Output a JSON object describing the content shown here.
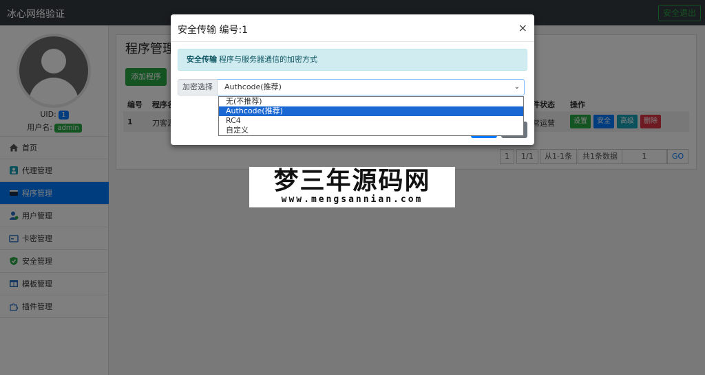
{
  "app": {
    "title": "冰心网络验证",
    "logout_label": "安全退出"
  },
  "user": {
    "uid_label": "UID:",
    "uid": "1",
    "name_label": "用户名:",
    "name": "admin"
  },
  "sidebar": {
    "items": [
      {
        "label": "首页",
        "icon": "home-icon"
      },
      {
        "label": "代理管理",
        "icon": "agent-icon"
      },
      {
        "label": "程序管理",
        "icon": "program-icon",
        "active": true
      },
      {
        "label": "用户管理",
        "icon": "user-icon"
      },
      {
        "label": "卡密管理",
        "icon": "card-icon"
      },
      {
        "label": "安全管理",
        "icon": "shield-icon"
      },
      {
        "label": "模板管理",
        "icon": "template-icon"
      },
      {
        "label": "插件管理",
        "icon": "plugin-icon"
      }
    ]
  },
  "main": {
    "title": "程序管理",
    "add_button": "添加程序",
    "table": {
      "headers": {
        "id": "编号",
        "name": "程序名",
        "status": "件状态",
        "actions": "操作"
      },
      "rows": [
        {
          "id": "1",
          "name": "刀客源",
          "status": "常运营"
        }
      ]
    },
    "row_buttons": {
      "settings": "设置",
      "security": "安全",
      "advanced": "高级",
      "delete": "删除"
    },
    "pager": {
      "page": "1",
      "pages": "1/1",
      "range": "从1-1条",
      "total": "共1条数据",
      "input": "1",
      "go": "GO"
    }
  },
  "modal": {
    "title": "安全传输 编号:1",
    "close": "×",
    "alert_strong": "安全传输",
    "alert_text": "程序与服务器通信的加密方式",
    "select_label": "加密选择",
    "selected": "Authcode(推荐)",
    "options": [
      "无(不推荐)",
      "Authcode(推荐)",
      "RC4",
      "自定义"
    ]
  },
  "watermark": {
    "title": "梦三年源码网",
    "url": "www.mengsannian.com"
  },
  "colors": {
    "primary": "#007bff",
    "success": "#28a745",
    "danger": "#dc3545",
    "info": "#17a2b8",
    "topbar": "#343a40"
  }
}
